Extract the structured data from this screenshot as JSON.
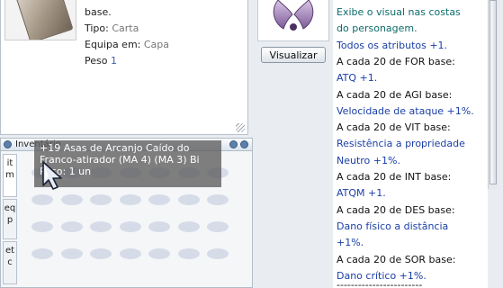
{
  "item_info": {
    "base_text": "base.",
    "tipo_label": "Tipo:",
    "tipo_value": "Carta",
    "equipa_label": "Equipa em:",
    "equipa_value": "Capa",
    "peso_label": "Peso",
    "peso_value": "1"
  },
  "inventory": {
    "title": "Inventário",
    "tabs": [
      "itm",
      "eqp",
      "etc"
    ],
    "tooltip": {
      "name": "+19 Asas de Arcanjo Caído do Franco-atirador (MA 4) (MA 3) Bi",
      "amount": "Peso: 1 un"
    }
  },
  "preview": {
    "visual_button_label": "Visualizar"
  },
  "description": {
    "lines": [
      {
        "text": "Exibe o visual nas costas",
        "color": "green"
      },
      {
        "text": "do personagem.",
        "color": "green"
      },
      {
        "text": "Todos os atributos +1.",
        "color": "blue"
      },
      {
        "text": "A cada 20 de FOR base:",
        "color": "black"
      },
      {
        "text": "ATQ +1.",
        "color": "blue"
      },
      {
        "text": "A cada 20 de AGI base:",
        "color": "black"
      },
      {
        "text": "Velocidade de ataque +1%.",
        "color": "blue"
      },
      {
        "text": "A cada 20 de VIT base:",
        "color": "black"
      },
      {
        "text": "Resistência a propriedade",
        "color": "blue"
      },
      {
        "text": "Neutro +1%.",
        "color": "blue"
      },
      {
        "text": "A cada 20 de INT base:",
        "color": "black"
      },
      {
        "text": "ATQM +1.",
        "color": "blue"
      },
      {
        "text": "A cada 20 de DES base:",
        "color": "black"
      },
      {
        "text": "Dano físico a distância",
        "color": "blue"
      },
      {
        "text": "+1%.",
        "color": "blue"
      },
      {
        "text": "A cada 20 de SOR base:",
        "color": "black"
      },
      {
        "text": "Dano crítico +1%.",
        "color": "blue"
      }
    ],
    "separator": "------------------------"
  },
  "colors": {
    "green": "#0d6b6b",
    "blue": "#1a3fa6",
    "black": "#111111"
  }
}
